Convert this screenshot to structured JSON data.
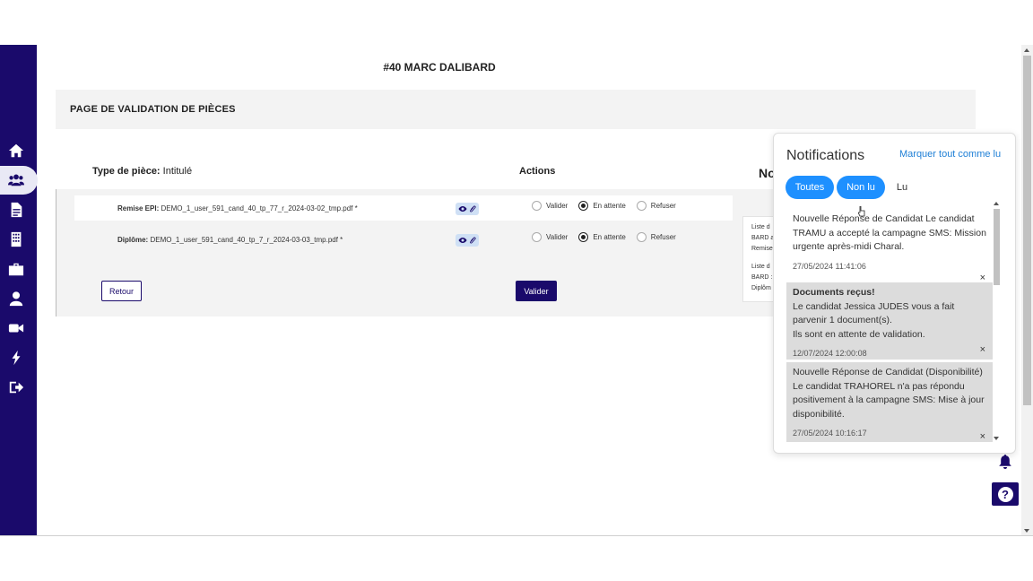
{
  "page": {
    "title": "#40 MARC DALIBARD",
    "section_header": "PAGE DE VALIDATION DE PIÈCES"
  },
  "table": {
    "col_type_label": "Type de pièce:",
    "col_type_sub": "Intitulé",
    "col_actions": "Actions",
    "col_notes": "No",
    "rows": [
      {
        "type": "Remise EPI:",
        "file": "DEMO_1_user_591_cand_40_tp_77_r_2024-03-02_tmp.pdf *",
        "selected": "En attente"
      },
      {
        "type": "Diplôme:",
        "file": "DEMO_1_user_591_cand_40_tp_7_r_2024-03-03_tmp.pdf *",
        "selected": "En attente"
      }
    ],
    "options": {
      "validate": "Valider",
      "pending": "En attente",
      "refuse": "Refuser"
    }
  },
  "buttons": {
    "back": "Retour",
    "submit": "Valider"
  },
  "notes_box": {
    "line1": "Liste d",
    "line2": "BARD a",
    "line3": "Remise",
    "line4": "Liste d",
    "line5": "BARD :",
    "line6": "Diplôm"
  },
  "notifications": {
    "title": "Notifications",
    "mark_all": "Marquer tout comme lu",
    "filters": {
      "all": "Toutes",
      "unread": "Non lu",
      "read": "Lu"
    },
    "items": [
      {
        "title": "Nouvelle Réponse de Candidat",
        "body": "Le candidat TRAMU a accepté la campagne SMS: Mission urgente après-midi Charal.",
        "time": "27/05/2024 11:41:06",
        "close": "×"
      },
      {
        "title": "Documents reçus!",
        "body1": "Le candidat Jessica JUDES vous a fait parvenir 1 document(s).",
        "body2": "Ils sont en attente de validation.",
        "time": "12/07/2024 12:00:08",
        "close": "×"
      },
      {
        "title": "Nouvelle Réponse de Candidat (Disponibilité)",
        "body": "Le candidat TRAHOREL n'a pas répondu positivement à la campagne SMS: Mise à jour disponibilité.",
        "time": "27/05/2024 10:16:17",
        "close": "×"
      }
    ]
  },
  "help_label": "?",
  "colors": {
    "brand": "#1a0a6b",
    "accent": "#1e90ff",
    "link": "#1e7fd6"
  }
}
